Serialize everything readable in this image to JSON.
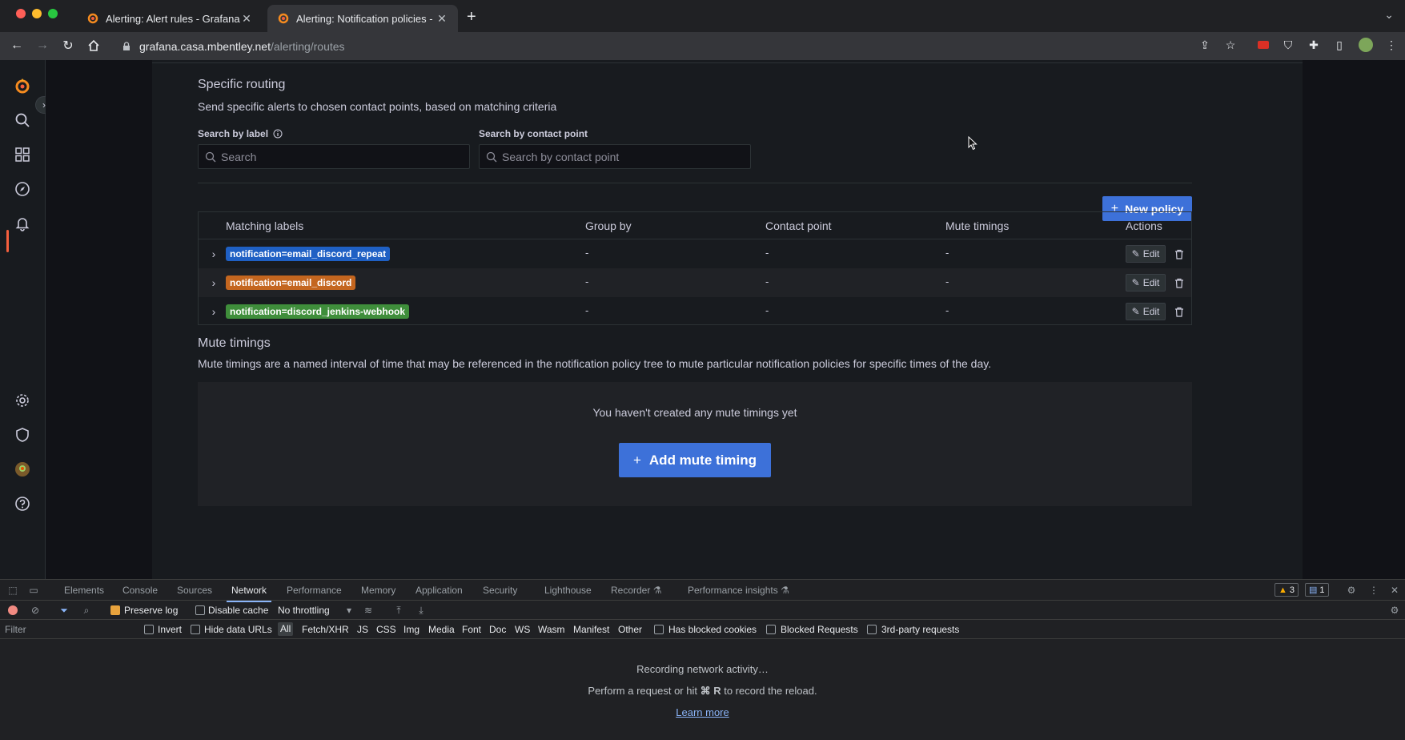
{
  "browser": {
    "tabs": [
      {
        "title": "Alerting: Alert rules - Grafana",
        "active": false
      },
      {
        "title": "Alerting: Notification policies -",
        "active": true
      }
    ],
    "url_host": "grafana.casa.mbentley.net",
    "url_path": "/alerting/routes"
  },
  "routing": {
    "title": "Specific routing",
    "description": "Send specific alerts to chosen contact points, based on matching criteria",
    "search_label_title": "Search by label",
    "search_label_placeholder": "Search",
    "search_contact_title": "Search by contact point",
    "search_contact_placeholder": "Search by contact point",
    "new_policy_label": "New policy"
  },
  "table": {
    "headers": [
      "Matching labels",
      "Group by",
      "Contact point",
      "Mute timings",
      "Actions"
    ],
    "rows": [
      {
        "label": "notification=email_discord_repeat",
        "group_by": "-",
        "contact_point": "-",
        "mute_timings": "-",
        "edit": "Edit",
        "color": "#1f60c4"
      },
      {
        "label": "notification=email_discord",
        "group_by": "-",
        "contact_point": "-",
        "mute_timings": "-",
        "edit": "Edit",
        "color": "#c4661f"
      },
      {
        "label": "notification=discord_jenkins-webhook",
        "group_by": "-",
        "contact_point": "-",
        "mute_timings": "-",
        "edit": "Edit",
        "color": "#3f8e3b"
      }
    ]
  },
  "mute": {
    "title": "Mute timings",
    "description": "Mute timings are a named interval of time that may be referenced in the notification policy tree to mute particular notification policies for specific times of the day.",
    "empty_text": "You haven't created any mute timings yet",
    "add_label": "Add mute timing"
  },
  "devtools": {
    "tabs": [
      "Elements",
      "Console",
      "Sources",
      "Network",
      "Performance",
      "Memory",
      "Application",
      "Security",
      "Lighthouse",
      "Recorder",
      "Performance insights"
    ],
    "active_tab": "Network",
    "warn_count": "3",
    "msg_count": "1",
    "preserve_log": "Preserve log",
    "disable_cache": "Disable cache",
    "throttling": "No throttling",
    "filter_placeholder": "Filter",
    "invert": "Invert",
    "hide_data_urls": "Hide data URLs",
    "filter_types": [
      "All",
      "Fetch/XHR",
      "JS",
      "CSS",
      "Img",
      "Media",
      "Font",
      "Doc",
      "WS",
      "Wasm",
      "Manifest",
      "Other"
    ],
    "has_blocked_cookies": "Has blocked cookies",
    "blocked_requests": "Blocked Requests",
    "third_party": "3rd-party requests",
    "recording": "Recording network activity…",
    "hint_pre": "Perform a request or hit",
    "hint_key": "⌘ R",
    "hint_post": "to record the reload.",
    "learn_more": "Learn more"
  },
  "colors": {
    "primary": "#3d71d9",
    "grafana_orange": "#f55f3e"
  }
}
